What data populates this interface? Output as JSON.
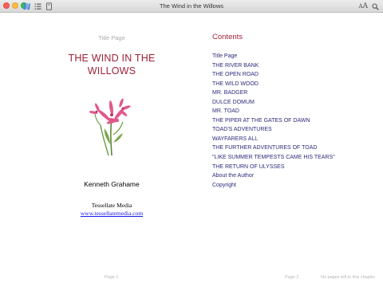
{
  "window": {
    "title": "The Wind in the Willows"
  },
  "toolbar": {
    "icons": [
      "library-icon",
      "toc-list-icon",
      "notes-icon"
    ],
    "font_size_small": "A",
    "font_size_large": "A",
    "search_icon": "search-icon"
  },
  "left_page": {
    "label": "Title Page",
    "title_line1": "THE WIND IN THE",
    "title_line2": "WILLOWS",
    "image": "pink-flower-illustration",
    "author": "Kenneth Grahame",
    "publisher": "Tessellate Media",
    "publisher_url": "www.tessellatemedia.com",
    "footer": "Page 1"
  },
  "right_page": {
    "contents_heading": "Contents",
    "toc": [
      "Title Page",
      "THE RIVER BANK",
      "THE OPEN ROAD",
      "THE WILD WOOD",
      "MR. BADGER",
      "DULCE DOMUM",
      "MR. TOAD",
      "THE PIPER AT THE GATES OF DAWN",
      "TOAD'S ADVENTURES",
      "WAYFARERS ALL",
      "THE FURTHER ADVENTURES OF TOAD",
      "\"LIKE SUMMER TEMPESTS CAME HIS TEARS\"",
      "THE RETURN OF ULYSSES",
      "About the Author",
      "Copyright"
    ],
    "footer_page": "Page 2",
    "footer_remaining": "No pages left in this chapter"
  },
  "colors": {
    "title_accent": "#9e2238",
    "toc_link": "#2d2a7a",
    "hyperlink": "#1a1aee"
  }
}
